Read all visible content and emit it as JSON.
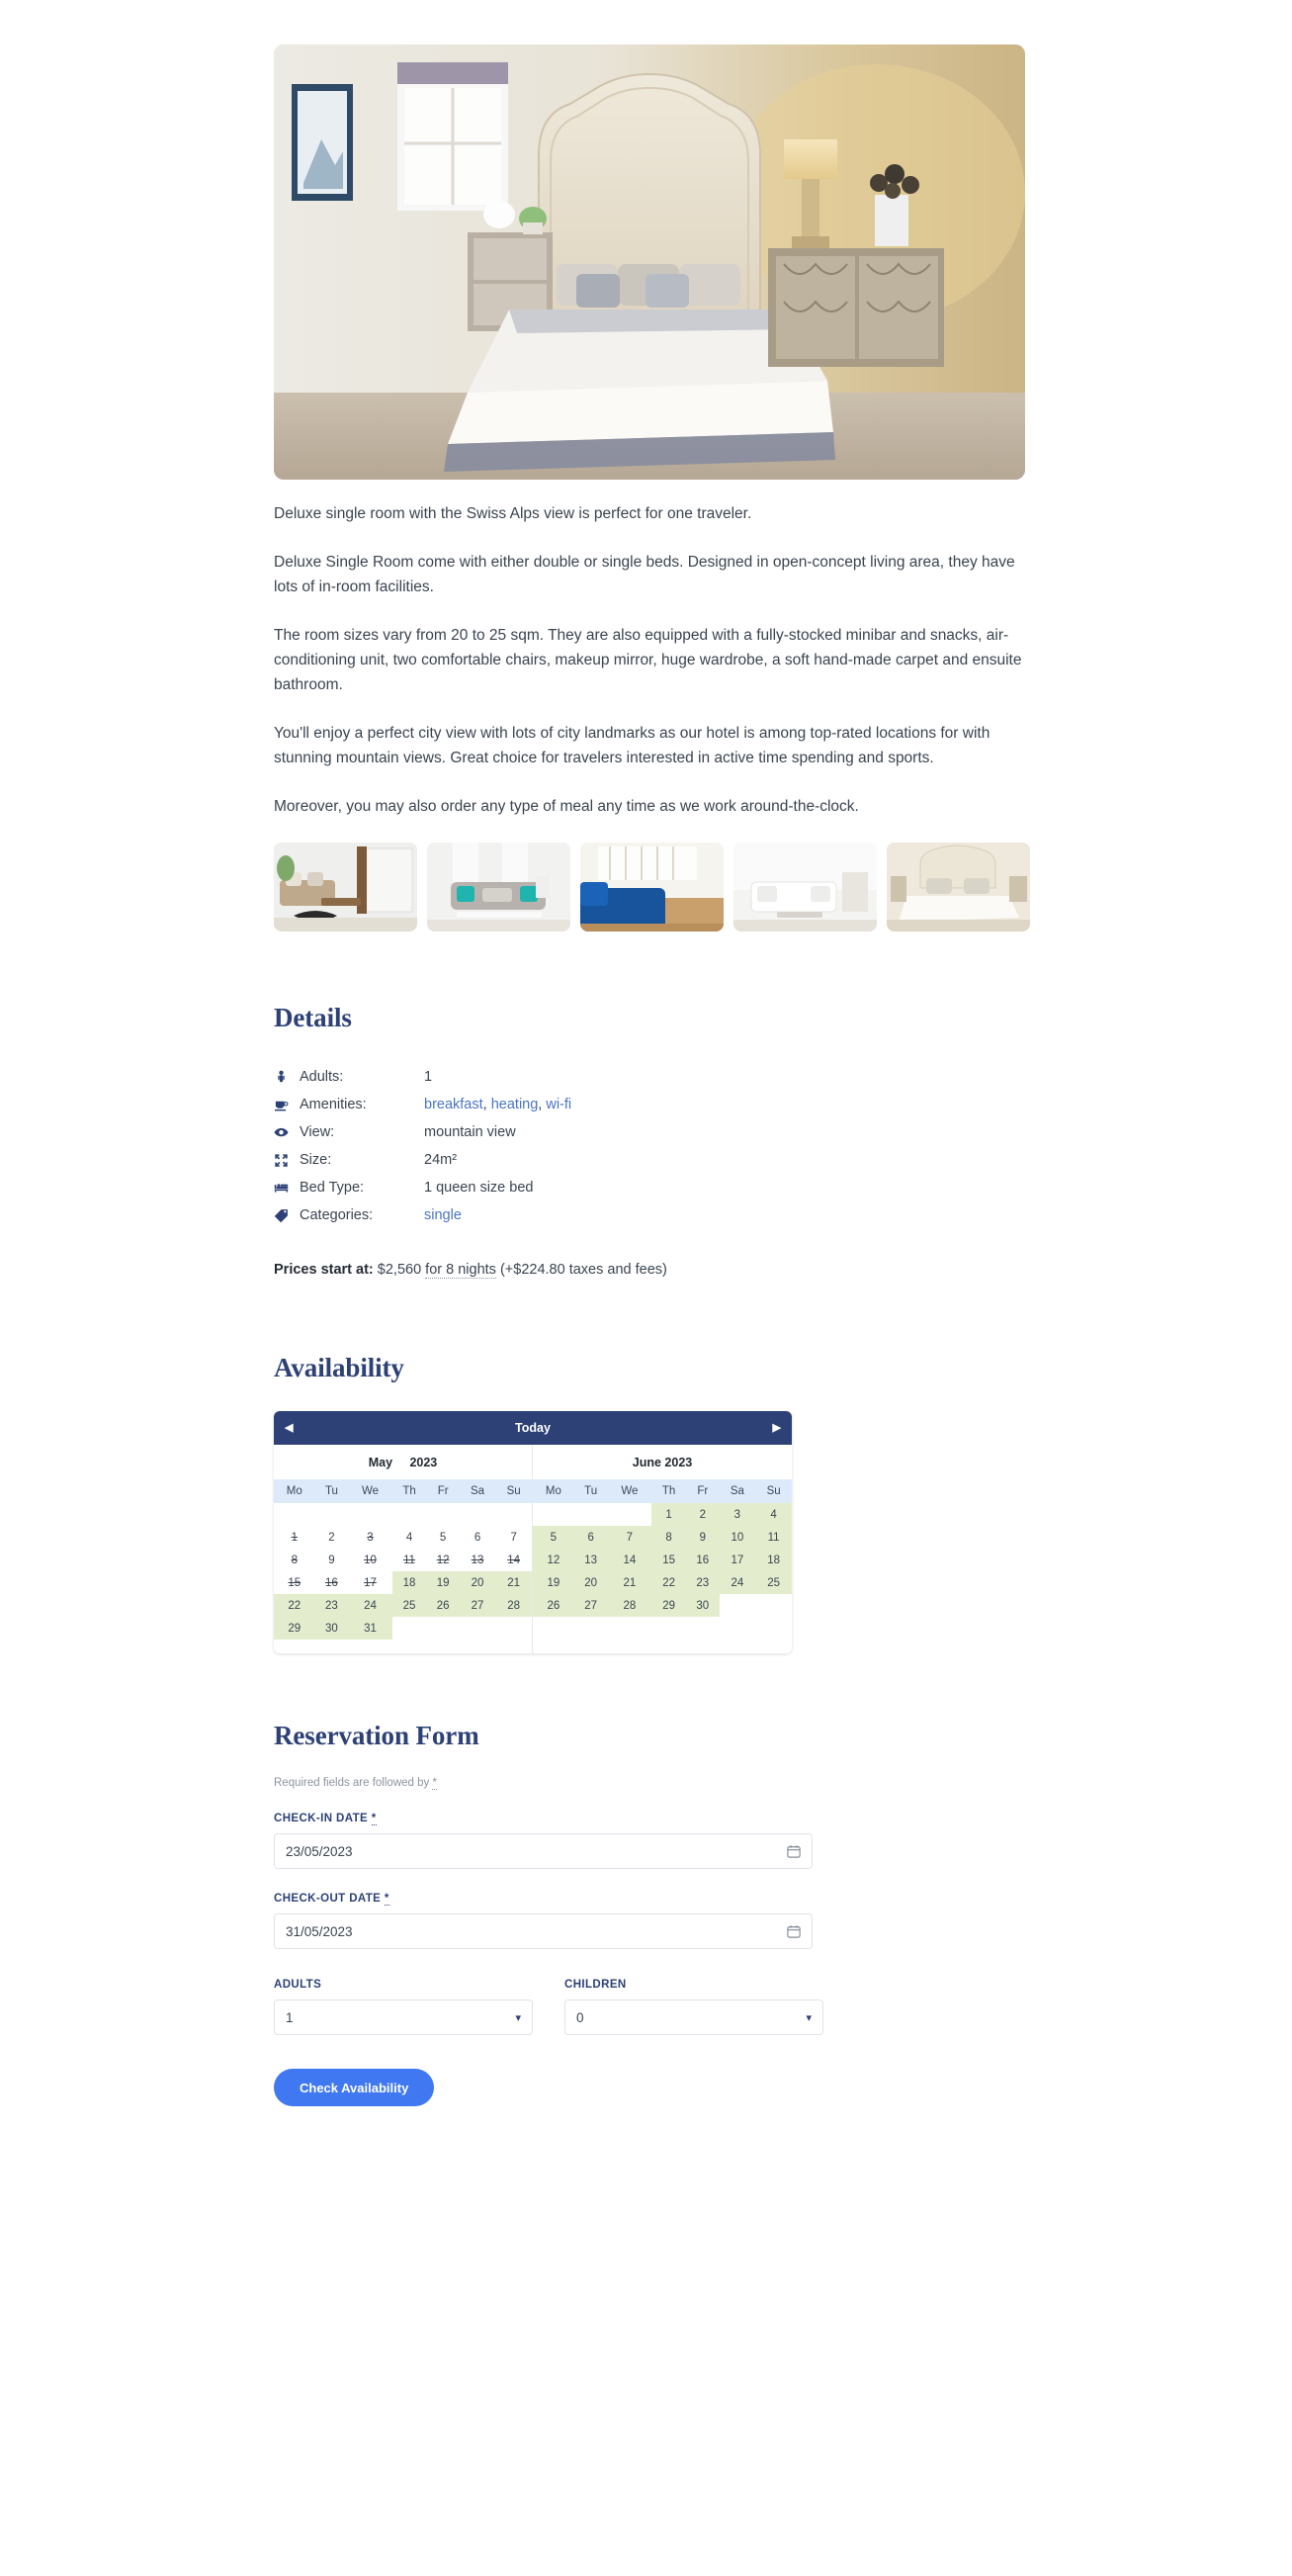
{
  "hero": {
    "alt": "deluxe-single-room-photo"
  },
  "description": {
    "paragraphs": [
      "Deluxe single room with the Swiss Alps view is perfect for one traveler.",
      "Deluxe Single Room come with either double or single beds. Designed in open-concept living area, they have lots of in-room facilities.",
      "The room sizes vary from 20 to 25 sqm. They are also equipped with a fully-stocked minibar and snacks, air-conditioning unit, two comfortable chairs, makeup mirror, huge wardrobe, a soft hand-made carpet and ensuite bathroom.",
      "You'll enjoy a perfect city view with lots of city landmarks as our hotel is among top-rated locations for with stunning mountain views. Great choice for travelers interested in active time spending and sports.",
      "Moreover, you may also order any type of meal any time as we work around-the-clock."
    ]
  },
  "gallery": {
    "thumbs": [
      {
        "name": "thumbnail-living-room-1"
      },
      {
        "name": "thumbnail-sofa-teal-2"
      },
      {
        "name": "thumbnail-blue-sofa-3"
      },
      {
        "name": "thumbnail-white-lounge-4"
      },
      {
        "name": "thumbnail-bedroom-5"
      }
    ]
  },
  "details": {
    "title": "Details",
    "rows": [
      {
        "icon": "person-icon",
        "label": "Adults:",
        "value": "1",
        "links": []
      },
      {
        "icon": "coffee-icon",
        "label": "Amenities:",
        "value": "",
        "links": [
          "breakfast",
          "heating",
          "wi-fi"
        ]
      },
      {
        "icon": "eye-icon",
        "label": "View:",
        "value": "mountain view",
        "links": []
      },
      {
        "icon": "expand-icon",
        "label": "Size:",
        "value": "24m²",
        "links": []
      },
      {
        "icon": "bed-icon",
        "label": "Bed Type:",
        "value": "1 queen size bed",
        "links": []
      },
      {
        "icon": "tag-icon",
        "label": "Categories:",
        "value": "",
        "links": [
          "single"
        ]
      }
    ],
    "price_label": "Prices start at:",
    "price_amount": "$2,560",
    "price_nights": "for 8 nights",
    "price_taxes": "(+$224.80 taxes and fees)"
  },
  "availability": {
    "title": "Availability",
    "today_label": "Today",
    "prev_icon": "chevron-left-icon",
    "next_icon": "chevron-right-icon",
    "weekdays": [
      "Mo",
      "Tu",
      "We",
      "Th",
      "Fr",
      "Sa",
      "Su"
    ],
    "months": [
      {
        "name": "May",
        "year": "2023",
        "title": "May 2023",
        "weeks": [
          [
            null,
            null,
            null,
            null,
            null,
            null,
            null
          ],
          [
            {
              "d": "1",
              "s": "unavail"
            },
            {
              "d": "2",
              "s": "past"
            },
            {
              "d": "3",
              "s": "unavail"
            },
            {
              "d": "4",
              "s": "past"
            },
            {
              "d": "5",
              "s": "past"
            },
            {
              "d": "6",
              "s": "past"
            },
            {
              "d": "7",
              "s": "past"
            }
          ],
          [
            {
              "d": "8",
              "s": "unavail"
            },
            {
              "d": "9",
              "s": "past"
            },
            {
              "d": "10",
              "s": "unavail"
            },
            {
              "d": "11",
              "s": "unavail"
            },
            {
              "d": "12",
              "s": "unavail"
            },
            {
              "d": "13",
              "s": "unavail"
            },
            {
              "d": "14",
              "s": "unavail"
            }
          ],
          [
            {
              "d": "15",
              "s": "unavail"
            },
            {
              "d": "16",
              "s": "unavail"
            },
            {
              "d": "17",
              "s": "unavail"
            },
            {
              "d": "18",
              "s": "avail"
            },
            {
              "d": "19",
              "s": "avail"
            },
            {
              "d": "20",
              "s": "avail"
            },
            {
              "d": "21",
              "s": "avail"
            }
          ],
          [
            {
              "d": "22",
              "s": "avail"
            },
            {
              "d": "23",
              "s": "avail"
            },
            {
              "d": "24",
              "s": "avail"
            },
            {
              "d": "25",
              "s": "avail"
            },
            {
              "d": "26",
              "s": "avail"
            },
            {
              "d": "27",
              "s": "avail"
            },
            {
              "d": "28",
              "s": "avail"
            }
          ],
          [
            {
              "d": "29",
              "s": "avail"
            },
            {
              "d": "30",
              "s": "avail"
            },
            {
              "d": "31",
              "s": "avail"
            },
            null,
            null,
            null,
            null
          ]
        ]
      },
      {
        "name": "June",
        "year": "2023",
        "title": "June 2023",
        "weeks": [
          [
            null,
            null,
            null,
            {
              "d": "1",
              "s": "avail"
            },
            {
              "d": "2",
              "s": "avail"
            },
            {
              "d": "3",
              "s": "avail"
            },
            {
              "d": "4",
              "s": "avail"
            }
          ],
          [
            {
              "d": "5",
              "s": "avail"
            },
            {
              "d": "6",
              "s": "avail"
            },
            {
              "d": "7",
              "s": "avail"
            },
            {
              "d": "8",
              "s": "avail"
            },
            {
              "d": "9",
              "s": "avail"
            },
            {
              "d": "10",
              "s": "avail"
            },
            {
              "d": "11",
              "s": "avail"
            }
          ],
          [
            {
              "d": "12",
              "s": "avail"
            },
            {
              "d": "13",
              "s": "avail"
            },
            {
              "d": "14",
              "s": "avail"
            },
            {
              "d": "15",
              "s": "avail"
            },
            {
              "d": "16",
              "s": "avail"
            },
            {
              "d": "17",
              "s": "avail"
            },
            {
              "d": "18",
              "s": "avail"
            }
          ],
          [
            {
              "d": "19",
              "s": "avail"
            },
            {
              "d": "20",
              "s": "avail"
            },
            {
              "d": "21",
              "s": "avail"
            },
            {
              "d": "22",
              "s": "avail"
            },
            {
              "d": "23",
              "s": "avail"
            },
            {
              "d": "24",
              "s": "avail"
            },
            {
              "d": "25",
              "s": "avail"
            }
          ],
          [
            {
              "d": "26",
              "s": "avail"
            },
            {
              "d": "27",
              "s": "avail"
            },
            {
              "d": "28",
              "s": "avail"
            },
            {
              "d": "29",
              "s": "avail"
            },
            {
              "d": "30",
              "s": "avail"
            },
            null,
            null
          ],
          [
            null,
            null,
            null,
            null,
            null,
            null,
            null
          ]
        ]
      }
    ]
  },
  "reservation": {
    "title": "Reservation Form",
    "required_note": "Required fields are followed by",
    "required_star": "*",
    "checkin": {
      "label": "CHECK-IN DATE",
      "star": "*",
      "value": "23/05/2023",
      "icon": "calendar-icon"
    },
    "checkout": {
      "label": "CHECK-OUT DATE",
      "star": "*",
      "value": "31/05/2023",
      "icon": "calendar-icon"
    },
    "adults": {
      "label": "ADULTS",
      "value": "1",
      "icon": "chevron-down-icon"
    },
    "children": {
      "label": "CHILDREN",
      "value": "0",
      "icon": "chevron-down-icon"
    },
    "submit_label": "Check Availability"
  },
  "colors": {
    "navy": "#2d4176",
    "link": "#4a74c9",
    "available": "#e3edcd",
    "weekday_bg": "#dceafa",
    "button": "#3f78f0"
  }
}
